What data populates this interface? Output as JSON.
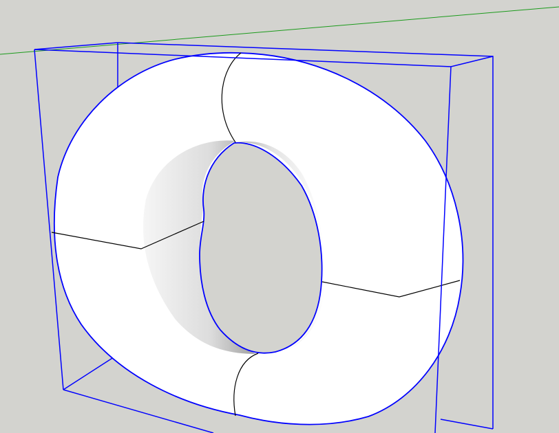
{
  "viewport": {
    "background": "#d3d3cf"
  },
  "scene": {
    "object": "torus",
    "selected": true,
    "colors": {
      "bounding_box": "#0000ff",
      "selection_edges": "#0000ff",
      "green_axis": "#1a9a1a",
      "surface": "#ffffff",
      "inner_shadow": "#8a8a8a",
      "seam_edges": "#000000"
    }
  }
}
